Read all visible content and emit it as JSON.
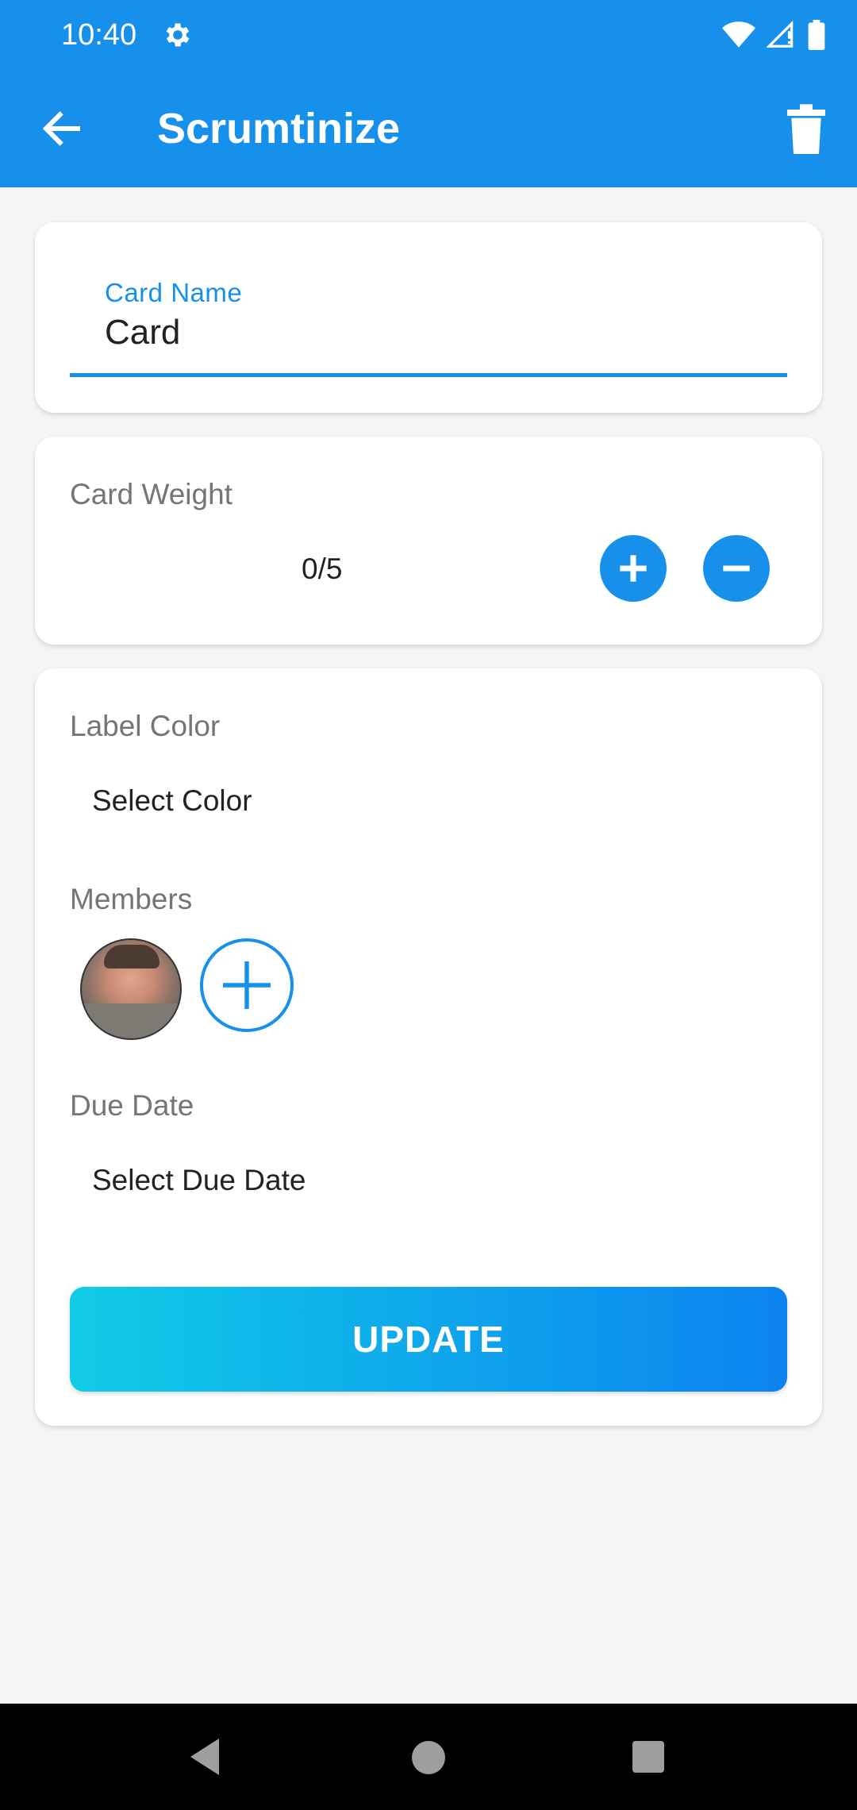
{
  "status_bar": {
    "time": "10:40",
    "icons": [
      "settings-icon",
      "wifi-icon",
      "signal-icon",
      "battery-icon"
    ]
  },
  "app_bar": {
    "title": "Scrumtinize",
    "back_icon": "arrow-left-icon",
    "delete_icon": "trash-icon"
  },
  "card_name": {
    "label": "Card Name",
    "value": "Card"
  },
  "card_weight": {
    "label": "Card Weight",
    "value": "0/5",
    "increment_icon": "plus-icon",
    "decrement_icon": "minus-icon"
  },
  "label_color": {
    "label": "Label Color",
    "select_text": "Select Color"
  },
  "members": {
    "label": "Members",
    "add_icon": "plus-icon"
  },
  "due_date": {
    "label": "Due Date",
    "select_text": "Select Due Date"
  },
  "actions": {
    "update_label": "UPDATE"
  },
  "colors": {
    "primary": "#1690ea",
    "gradient_start": "#10cce6",
    "gradient_end": "#0c83f0",
    "background": "#f5f5f5"
  }
}
